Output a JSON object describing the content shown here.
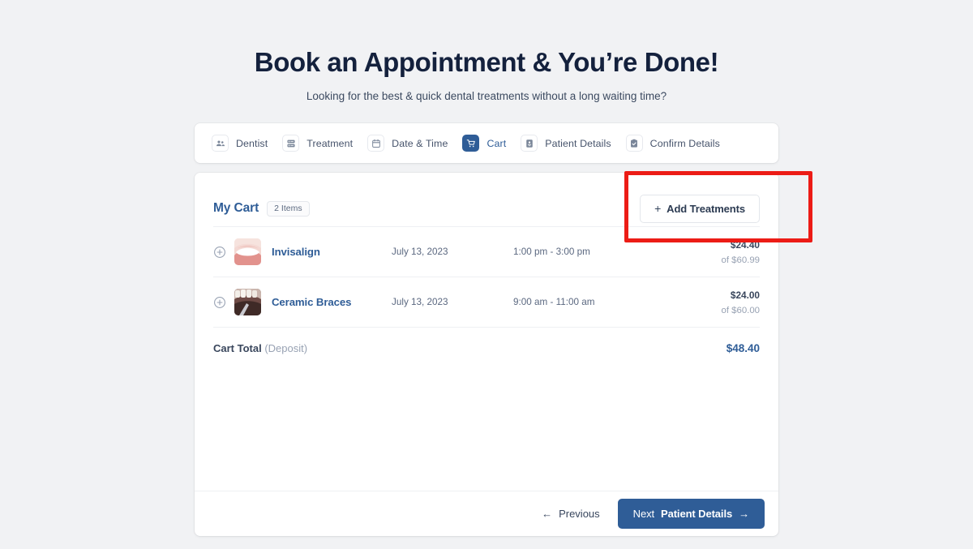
{
  "header": {
    "title": "Book an Appointment & You’re Done!",
    "subtitle": "Looking for the best & quick dental treatments without a long waiting time?"
  },
  "steps": [
    {
      "label": "Dentist",
      "icon": "people-icon",
      "active": false
    },
    {
      "label": "Treatment",
      "icon": "list-icon",
      "active": false
    },
    {
      "label": "Date & Time",
      "icon": "calendar-icon",
      "active": false
    },
    {
      "label": "Cart",
      "icon": "cart-icon",
      "active": true
    },
    {
      "label": "Patient Details",
      "icon": "id-card-icon",
      "active": false
    },
    {
      "label": "Confirm Details",
      "icon": "clipboard-check-icon",
      "active": false
    }
  ],
  "cart": {
    "title": "My Cart",
    "items_badge": "2 Items",
    "add_button_label": "Add Treatments",
    "add_button_plus": "+",
    "rows": [
      {
        "name": "Invisalign",
        "date": "July 13, 2023",
        "time": "1:00 pm - 3:00 pm",
        "price": "$24.40",
        "price_of": "of $60.99",
        "thumb": "invisalign-photo"
      },
      {
        "name": "Ceramic Braces",
        "date": "July 13, 2023",
        "time": "9:00 am - 11:00 am",
        "price": "$24.00",
        "price_of": "of $60.00",
        "thumb": "ceramic-braces-photo"
      }
    ],
    "total_label": "Cart Total",
    "total_note": "(Deposit)",
    "total_value": "$48.40"
  },
  "footer": {
    "previous_label": "Previous",
    "previous_arrow": "←",
    "next_prefix": "Next",
    "next_label": "Patient Details",
    "next_arrow": "→"
  },
  "annotation": {
    "highlight_color": "#ec1c16",
    "target": "add-treatments-button"
  },
  "colors": {
    "background": "#f1f2f4",
    "card": "#ffffff",
    "accent_blue": "#2f5d97",
    "title_navy": "#14213d",
    "muted_text": "#98a2b3"
  }
}
